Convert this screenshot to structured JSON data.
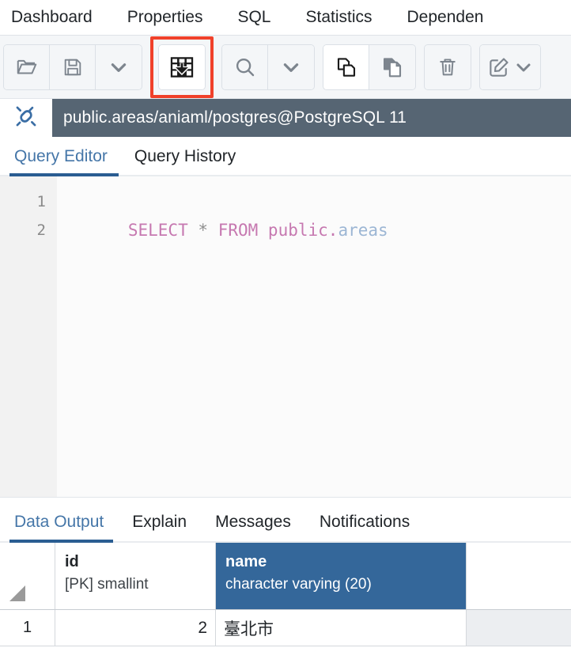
{
  "object_tabs": [
    {
      "label": "Dashboard"
    },
    {
      "label": "Properties"
    },
    {
      "label": "SQL"
    },
    {
      "label": "Statistics"
    },
    {
      "label": "Dependen"
    }
  ],
  "toolbar": {
    "groups": [
      {
        "buttons": [
          {
            "name": "open-file-button",
            "icon": "open-folder-icon",
            "state": "normal"
          },
          {
            "name": "save-file-button",
            "icon": "floppy-save-icon",
            "state": "normal"
          },
          {
            "name": "save-dropdown-button",
            "icon": "chevron-down-icon",
            "state": "normal"
          }
        ]
      },
      {
        "highlighted": true,
        "buttons": [
          {
            "name": "execute-download-button",
            "icon": "table-download-icon",
            "state": "active"
          }
        ]
      },
      {
        "buttons": [
          {
            "name": "find-button",
            "icon": "search-icon",
            "state": "normal"
          },
          {
            "name": "find-dropdown-button",
            "icon": "chevron-down-icon",
            "state": "normal"
          }
        ]
      },
      {
        "buttons": [
          {
            "name": "copy-button",
            "icon": "copy-icon",
            "state": "active"
          },
          {
            "name": "paste-button",
            "icon": "paste-icon",
            "state": "normal"
          }
        ]
      },
      {
        "buttons": [
          {
            "name": "delete-button",
            "icon": "trash-icon",
            "state": "normal"
          }
        ]
      },
      {
        "buttons": [
          {
            "name": "edit-button",
            "icon": "pencil-edit-icon",
            "state": "normal"
          },
          {
            "name": "edit-dropdown-button",
            "icon": "chevron-down-icon",
            "state": "normal"
          }
        ]
      }
    ],
    "highlight_color": "#f0412a"
  },
  "connection": {
    "icon": "plug-connection-icon",
    "title": "public.areas/aniaml/postgres@PostgreSQL 11",
    "bar_color": "#566573",
    "icon_color": "#3b6ea5"
  },
  "panel_tabs": [
    {
      "label": "Query Editor",
      "active": true
    },
    {
      "label": "Query History",
      "active": false
    }
  ],
  "editor": {
    "line_numbers": [
      "1",
      "2"
    ],
    "sql": {
      "keyword1": "SELECT",
      "star": "*",
      "keyword2": "FROM",
      "schema": "public",
      "dot": ".",
      "table": "areas"
    },
    "full_text": "SELECT * FROM public.areas"
  },
  "output_tabs": [
    {
      "label": "Data Output",
      "active": true
    },
    {
      "label": "Explain",
      "active": false
    },
    {
      "label": "Messages",
      "active": false
    },
    {
      "label": "Notifications",
      "active": false
    }
  ],
  "grid": {
    "corner_icon": "select-all-triangle-icon",
    "columns": [
      {
        "name": "id",
        "type": "[PK] smallint",
        "selected": false
      },
      {
        "name": "name",
        "type": "character varying (20)",
        "selected": true
      }
    ],
    "selected_header_color": "#34679a",
    "rows": [
      {
        "num": "1",
        "id": "2",
        "name": "臺北市"
      }
    ]
  }
}
